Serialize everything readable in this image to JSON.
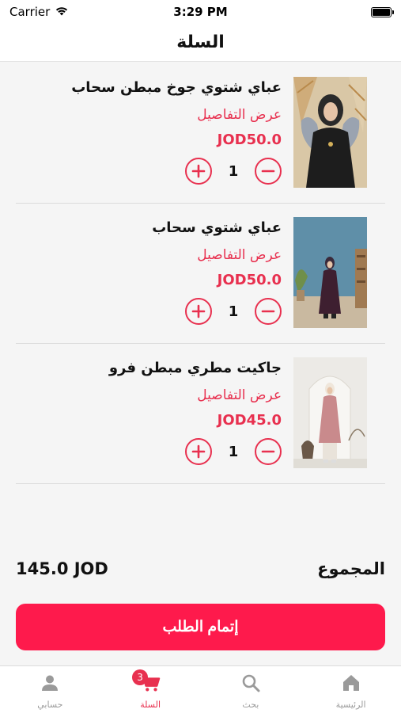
{
  "status_bar": {
    "carrier": "Carrier",
    "time": "3:29 PM"
  },
  "header": {
    "title": "السلة"
  },
  "cart": {
    "items": [
      {
        "name": "عباي شتوي جوخ مبطن سحاب",
        "details_label": "عرض التفاصيل",
        "price": "JOD50.0",
        "quantity": "1"
      },
      {
        "name": "عباي شتوي  سحاب",
        "details_label": "عرض التفاصيل",
        "price": "JOD50.0",
        "quantity": "1"
      },
      {
        "name": "جاكيت مطري مبطن فرو",
        "details_label": "عرض التفاصيل",
        "price": "JOD45.0",
        "quantity": "1"
      }
    ]
  },
  "summary": {
    "total_label": "المجموع",
    "total_amount": "145.0 JOD"
  },
  "checkout": {
    "label": "إتمام الطلب"
  },
  "tabs": {
    "account": {
      "label": "حسابي"
    },
    "cart": {
      "label": "السلة",
      "badge": "3"
    },
    "search": {
      "label": "بحث"
    },
    "home": {
      "label": "الرئيسية"
    }
  },
  "colors": {
    "accent": "#e8304f",
    "checkout": "#fe1a4c",
    "inactive": "#9a9a9a"
  }
}
